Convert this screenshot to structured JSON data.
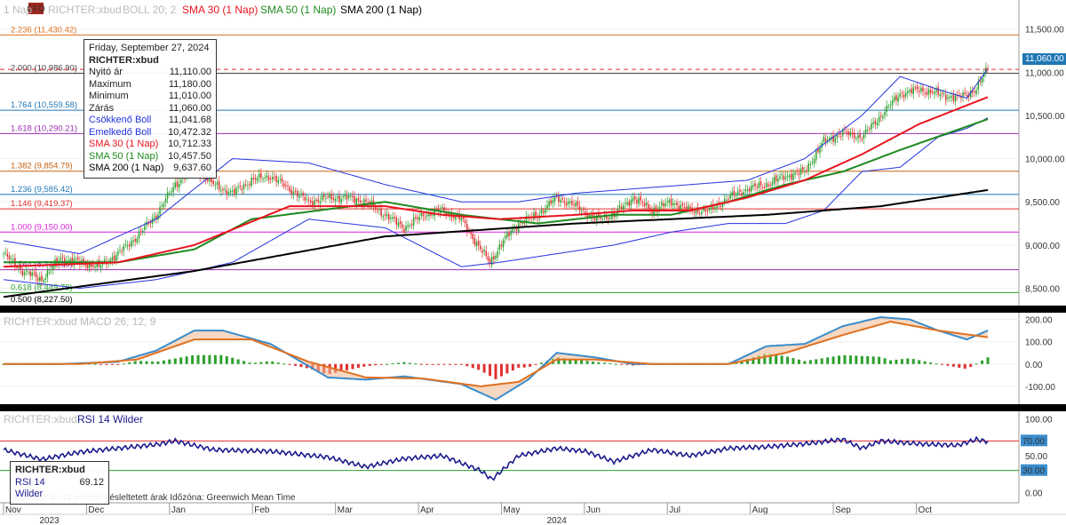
{
  "header": {
    "badge": "CFD",
    "prefix": "1 Nap",
    "symbol": "RICHTER:xbud",
    "boll": "BOLL 20; 2",
    "sma30": "SMA 30 (1 Nap)",
    "sma50": "SMA 50 (1 Nap)",
    "sma200": "SMA 200 (1 Nap)"
  },
  "colors": {
    "up": "#2ca02c",
    "down": "#e03030",
    "sma30": "#e8141e",
    "sma50": "#1f8a1f",
    "sma200": "#000000",
    "boll": "#2233dd",
    "macd": "#3a8ccc",
    "signal": "#e07020",
    "rsi": "#1a1a8c",
    "last": "#1f77b4"
  },
  "tooltip": {
    "date": "Friday, September 27, 2024",
    "symbol": "RICHTER:xbud",
    "rows": [
      {
        "label": "Nyitó ár",
        "value": "11,110.00"
      },
      {
        "label": "Maximum",
        "value": "11,180.00"
      },
      {
        "label": "Minimum",
        "value": "11,010.00"
      },
      {
        "label": "Zárás",
        "value": "11,060.00"
      }
    ],
    "indicators": [
      {
        "label": "Csökkenő Boll",
        "value": "11,041.68",
        "color": "#2233dd"
      },
      {
        "label": "Emelkedő Boll",
        "value": "10,472.32",
        "color": "#2233dd"
      },
      {
        "label": "SMA 30 (1 Nap)",
        "value": "10,712.33",
        "color": "#e8141e"
      },
      {
        "label": "SMA 50 (1 Nap)",
        "value": "10,457.50",
        "color": "#1f8a1f"
      },
      {
        "label": "SMA 200 (1 Nap)",
        "value": "9,637.60",
        "color": "#000000"
      }
    ]
  },
  "last_price": "11,060.00",
  "macd_title": "RICHTER:xbud MACD 26, 12, 9",
  "rsi_title": "RICHTER:xbud",
  "rsi_name": "RSI 14 Wilder",
  "rsi_tip": {
    "symbol": "RICHTER:xbud",
    "label": "RSI 14 Wilder",
    "value": "69.12"
  },
  "footer": "Indikátor ár: 15 perccel késleltetett árak    Időzóna: Greenwich Mean Time",
  "chart_data": [
    {
      "type": "candlestick",
      "title": "RICHTER:xbud",
      "ylim": [
        8300,
        11650
      ],
      "y_ticks": [
        "11,500.00",
        "11,000.00",
        "10,500.00",
        "10,000.00",
        "9,500.00",
        "9,000.00",
        "8,500.00"
      ],
      "y_tick_values": [
        11500,
        11000,
        10500,
        10000,
        9500,
        9000,
        8500
      ],
      "fib_levels": [
        {
          "label": "2.236 (11,430.42)",
          "value": 11430.42,
          "color": "#e07020"
        },
        {
          "label": "2.000 (10,986.90)",
          "value": 10986.9,
          "color": "#444444"
        },
        {
          "label": "1.764 (10,559.58)",
          "value": 10559.58,
          "color": "#1f77b4"
        },
        {
          "label": "1.618 (10,290.21)",
          "value": 10290.21,
          "color": "#9b30b0"
        },
        {
          "label": "1.382 (9,854.79)",
          "value": 9854.79,
          "color": "#c86414"
        },
        {
          "label": "1.236 (9,585.42)",
          "value": 9585.42,
          "color": "#1f77b4"
        },
        {
          "label": "1.146 (9,419.37)",
          "value": 9419.37,
          "color": "#e03030"
        },
        {
          "label": "1.000 (9,150.00)",
          "value": 9150.0,
          "color": "#e020e0"
        },
        {
          "label": "0.764 (8,714.58)",
          "value": 8714.58,
          "color": "#9b30b0"
        },
        {
          "label": "0.618 (8,449.79)",
          "value": 8449.79,
          "color": "#2ca02c"
        },
        {
          "label": "0.500 (8,227.50)",
          "value": 8227.5,
          "color": "#000000"
        }
      ],
      "close_anchors": [
        [
          0,
          8900
        ],
        [
          10,
          8700
        ],
        [
          20,
          8600
        ],
        [
          30,
          8850
        ],
        [
          40,
          8800
        ],
        [
          50,
          8750
        ],
        [
          60,
          8900
        ],
        [
          70,
          9100
        ],
        [
          80,
          9350
        ],
        [
          90,
          9700
        ],
        [
          100,
          9900
        ],
        [
          110,
          9700
        ],
        [
          120,
          9600
        ],
        [
          130,
          9750
        ],
        [
          140,
          9800
        ],
        [
          150,
          9650
        ],
        [
          160,
          9500
        ],
        [
          170,
          9550
        ],
        [
          180,
          9550
        ],
        [
          190,
          9500
        ],
        [
          200,
          9350
        ],
        [
          210,
          9200
        ],
        [
          220,
          9350
        ],
        [
          230,
          9400
        ],
        [
          240,
          9300
        ],
        [
          250,
          8950
        ],
        [
          255,
          8800
        ],
        [
          262,
          9050
        ],
        [
          270,
          9250
        ],
        [
          280,
          9350
        ],
        [
          290,
          9550
        ],
        [
          300,
          9450
        ],
        [
          310,
          9300
        ],
        [
          320,
          9350
        ],
        [
          330,
          9550
        ],
        [
          340,
          9400
        ],
        [
          350,
          9500
        ],
        [
          360,
          9400
        ],
        [
          370,
          9400
        ],
        [
          380,
          9550
        ],
        [
          390,
          9650
        ],
        [
          400,
          9700
        ],
        [
          410,
          9800
        ],
        [
          420,
          9850
        ],
        [
          430,
          10200
        ],
        [
          440,
          10300
        ],
        [
          450,
          10250
        ],
        [
          460,
          10500
        ],
        [
          470,
          10750
        ],
        [
          480,
          10800
        ],
        [
          490,
          10750
        ],
        [
          500,
          10700
        ],
        [
          510,
          10800
        ],
        [
          516,
          11060
        ]
      ],
      "sma30_anchors": [
        [
          0,
          8750
        ],
        [
          60,
          8800
        ],
        [
          100,
          9000
        ],
        [
          150,
          9450
        ],
        [
          200,
          9450
        ],
        [
          230,
          9350
        ],
        [
          260,
          9300
        ],
        [
          300,
          9350
        ],
        [
          330,
          9400
        ],
        [
          360,
          9400
        ],
        [
          390,
          9550
        ],
        [
          420,
          9750
        ],
        [
          450,
          10050
        ],
        [
          480,
          10400
        ],
        [
          516,
          10712
        ]
      ],
      "sma50_anchors": [
        [
          0,
          8800
        ],
        [
          60,
          8800
        ],
        [
          100,
          8950
        ],
        [
          130,
          9300
        ],
        [
          200,
          9500
        ],
        [
          240,
          9350
        ],
        [
          280,
          9250
        ],
        [
          320,
          9350
        ],
        [
          350,
          9350
        ],
        [
          380,
          9500
        ],
        [
          410,
          9700
        ],
        [
          440,
          9850
        ],
        [
          470,
          10100
        ],
        [
          516,
          10457
        ]
      ],
      "sma200_anchors": [
        [
          0,
          8400
        ],
        [
          100,
          8700
        ],
        [
          200,
          9100
        ],
        [
          300,
          9250
        ],
        [
          400,
          9350
        ],
        [
          460,
          9450
        ],
        [
          516,
          9637
        ]
      ],
      "boll_upper_anchors": [
        [
          0,
          9050
        ],
        [
          40,
          8900
        ],
        [
          80,
          9300
        ],
        [
          120,
          10000
        ],
        [
          160,
          9950
        ],
        [
          200,
          9700
        ],
        [
          240,
          9500
        ],
        [
          270,
          9500
        ],
        [
          300,
          9600
        ],
        [
          330,
          9650
        ],
        [
          360,
          9700
        ],
        [
          390,
          9750
        ],
        [
          420,
          10000
        ],
        [
          450,
          10500
        ],
        [
          470,
          10950
        ],
        [
          490,
          10800
        ],
        [
          505,
          10700
        ],
        [
          516,
          11041
        ]
      ],
      "boll_lower_anchors": [
        [
          0,
          8600
        ],
        [
          40,
          8500
        ],
        [
          80,
          8600
        ],
        [
          120,
          8800
        ],
        [
          160,
          9300
        ],
        [
          200,
          9200
        ],
        [
          240,
          8750
        ],
        [
          260,
          8800
        ],
        [
          290,
          8900
        ],
        [
          320,
          9000
        ],
        [
          350,
          9150
        ],
        [
          380,
          9250
        ],
        [
          410,
          9250
        ],
        [
          430,
          9400
        ],
        [
          450,
          9850
        ],
        [
          470,
          9900
        ],
        [
          490,
          10250
        ],
        [
          505,
          10350
        ],
        [
          516,
          10472
        ]
      ]
    },
    {
      "type": "macd",
      "title": "RICHTER:xbud MACD 26, 12, 9",
      "ylim": [
        -180,
        230
      ],
      "y_ticks": [
        "200.00",
        "100.00",
        "0.00",
        "-100.00"
      ],
      "y_tick_values": [
        200,
        100,
        0,
        -100
      ],
      "macd_anchors": [
        [
          0,
          0
        ],
        [
          30,
          0
        ],
        [
          60,
          10
        ],
        [
          80,
          60
        ],
        [
          100,
          150
        ],
        [
          115,
          150
        ],
        [
          140,
          90
        ],
        [
          170,
          -60
        ],
        [
          190,
          -70
        ],
        [
          210,
          -55
        ],
        [
          240,
          -90
        ],
        [
          258,
          -160
        ],
        [
          275,
          -70
        ],
        [
          290,
          50
        ],
        [
          300,
          40
        ],
        [
          310,
          30
        ],
        [
          330,
          0
        ],
        [
          350,
          0
        ],
        [
          380,
          0
        ],
        [
          400,
          80
        ],
        [
          420,
          90
        ],
        [
          440,
          170
        ],
        [
          460,
          210
        ],
        [
          475,
          200
        ],
        [
          490,
          150
        ],
        [
          505,
          110
        ],
        [
          516,
          150
        ]
      ],
      "signal_anchors": [
        [
          0,
          0
        ],
        [
          40,
          0
        ],
        [
          70,
          20
        ],
        [
          100,
          110
        ],
        [
          130,
          110
        ],
        [
          160,
          10
        ],
        [
          190,
          -60
        ],
        [
          220,
          -65
        ],
        [
          250,
          -100
        ],
        [
          270,
          -80
        ],
        [
          290,
          20
        ],
        [
          310,
          20
        ],
        [
          340,
          0
        ],
        [
          380,
          0
        ],
        [
          410,
          50
        ],
        [
          440,
          130
        ],
        [
          465,
          190
        ],
        [
          490,
          150
        ],
        [
          516,
          120
        ]
      ]
    },
    {
      "type": "rsi",
      "title": "RSI 14 Wilder",
      "ylim": [
        -10,
        110
      ],
      "y_ticks": [
        "100.00",
        "50.00",
        "0.00"
      ],
      "y_tick_values": [
        100,
        50,
        0
      ],
      "bands": [
        70,
        30
      ],
      "band_labels": [
        "70.00",
        "30.00"
      ],
      "rsi_anchors": [
        [
          0,
          58
        ],
        [
          20,
          45
        ],
        [
          40,
          55
        ],
        [
          60,
          60
        ],
        [
          80,
          65
        ],
        [
          90,
          70
        ],
        [
          110,
          58
        ],
        [
          140,
          56
        ],
        [
          170,
          48
        ],
        [
          190,
          35
        ],
        [
          210,
          46
        ],
        [
          230,
          50
        ],
        [
          250,
          30
        ],
        [
          256,
          18
        ],
        [
          270,
          50
        ],
        [
          290,
          60
        ],
        [
          305,
          56
        ],
        [
          320,
          42
        ],
        [
          340,
          58
        ],
        [
          360,
          50
        ],
        [
          380,
          60
        ],
        [
          400,
          62
        ],
        [
          420,
          66
        ],
        [
          440,
          72
        ],
        [
          450,
          60
        ],
        [
          460,
          70
        ],
        [
          480,
          66
        ],
        [
          500,
          64
        ],
        [
          510,
          72
        ],
        [
          516,
          69
        ]
      ]
    }
  ],
  "x_axis": {
    "months": [
      "Nov",
      "Dec",
      "Jan",
      "Feb",
      "Mar",
      "Apr",
      "May",
      "Jun",
      "Jul",
      "Aug",
      "Sep",
      "Oct"
    ],
    "years": [
      "2023",
      "2024"
    ]
  }
}
